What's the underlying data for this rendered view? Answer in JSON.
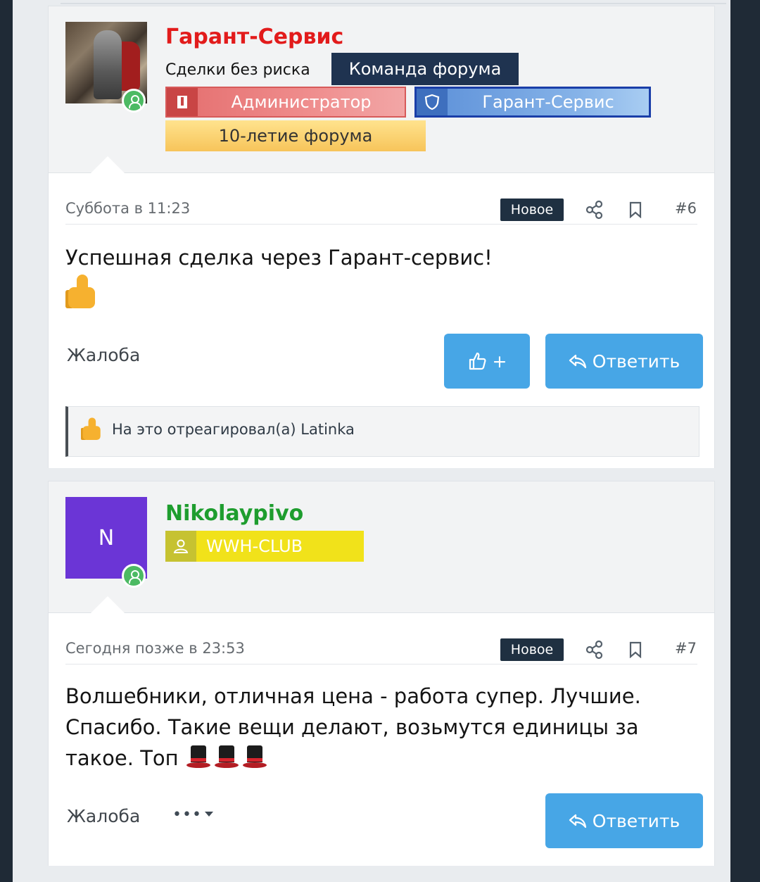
{
  "posts": [
    {
      "username": "Гарант-Сервис",
      "user_title": "Сделки без риска",
      "team_banner": "Команда форума",
      "banners": {
        "admin": "Администратор",
        "garant": "Гарант-Сервис",
        "anniversary": "10-летие форума"
      },
      "date": "Суббота в 11:23",
      "new_label": "Новое",
      "post_number": "#6",
      "message": "Успешная сделка через Гарант-сервис!",
      "report": "Жалоба",
      "like_label": "+",
      "reply_label": "Ответить",
      "reactions_text": "На это отреагировал(а) Latinka"
    },
    {
      "username": "Nikolaypivo",
      "avatar_letter": "N",
      "banners": {
        "club": "WWH-CLUB"
      },
      "date": "Сегодня позже в 23:53",
      "new_label": "Новое",
      "post_number": "#7",
      "message": "Волшебники, отличная цена - работа супер. Лучшие. Спасибо. Такие вещи делают, возьмутся единицы за такое. Топ",
      "report": "Жалоба",
      "more_label": "•••",
      "reply_label": "Ответить"
    }
  ],
  "icons": {
    "online": "user-online-icon",
    "share": "share-icon",
    "bookmark": "bookmark-icon",
    "like": "thumbs-up-icon",
    "reply": "reply-arrow-icon",
    "shield": "shield-icon",
    "user": "user-icon",
    "tie": "tie-icon"
  },
  "colors": {
    "admin_name": "#e21b1b",
    "member_name": "#1e9d2e",
    "button": "#47a6e6",
    "team_banner": "#1f3350"
  }
}
